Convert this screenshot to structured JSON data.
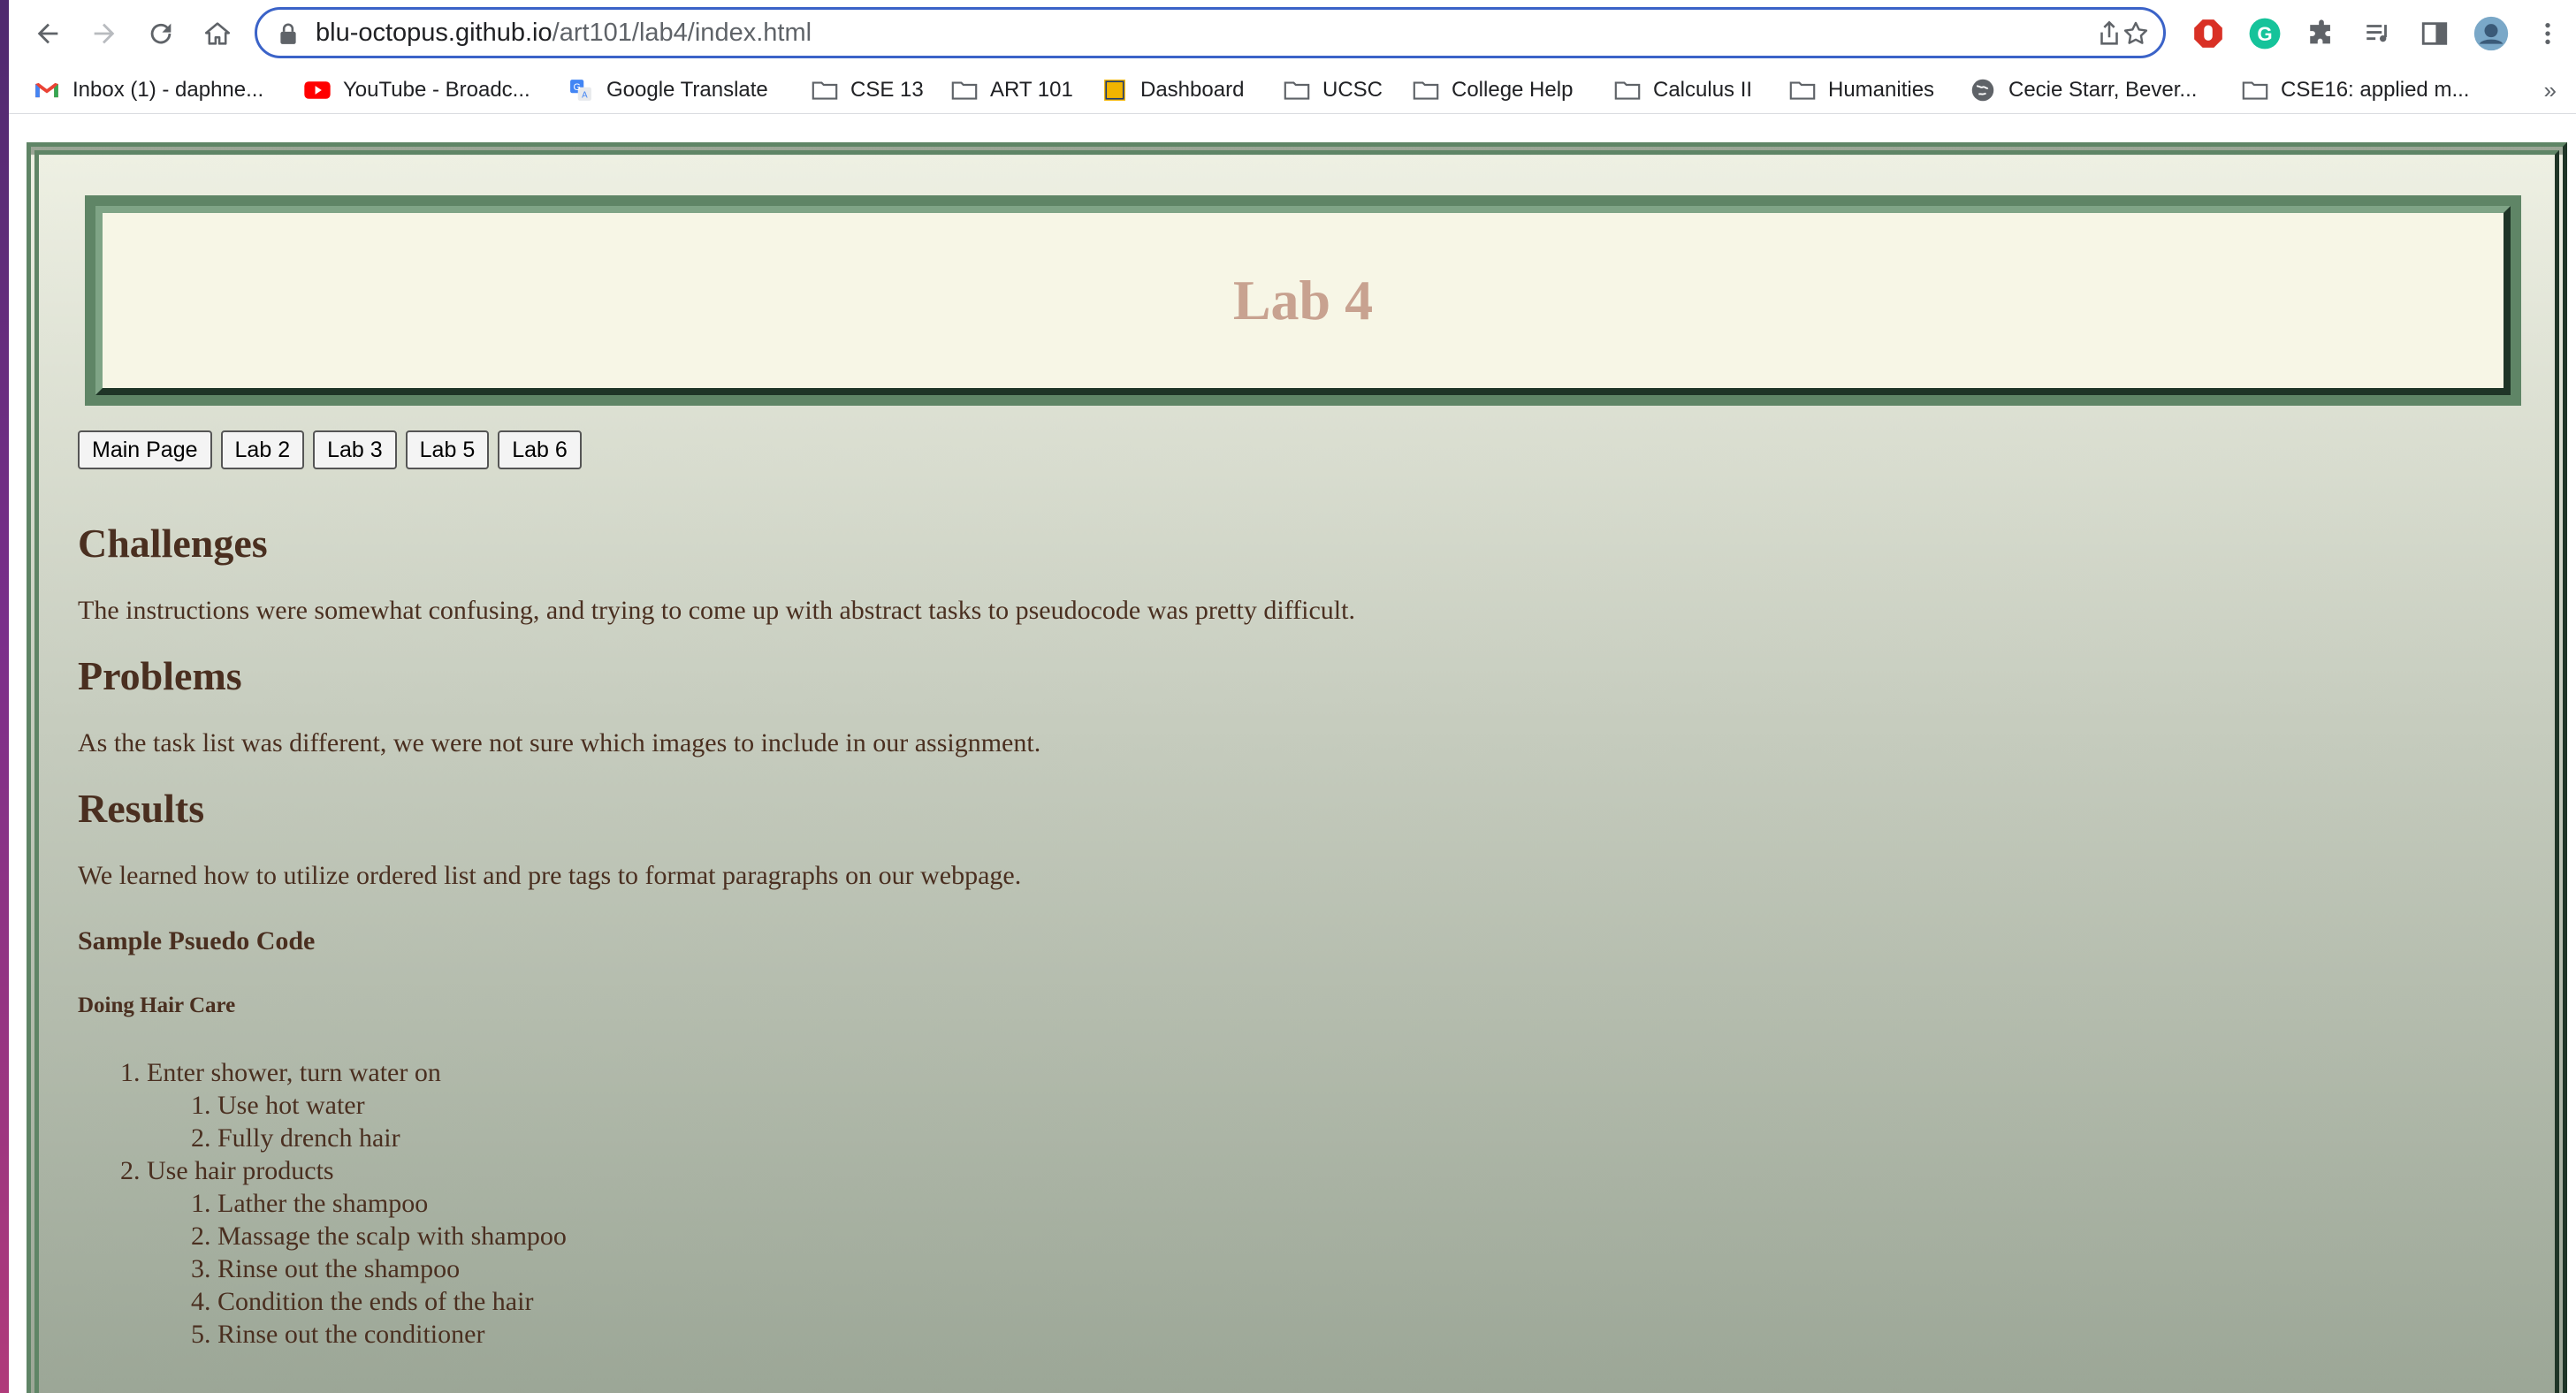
{
  "browser": {
    "url_host": "blu-octopus.github.io",
    "url_path": "/art101/lab4/index.html",
    "bookmarks": [
      {
        "label": "Inbox (1) - daphne...",
        "icon": "gmail-icon"
      },
      {
        "label": "YouTube - Broadc...",
        "icon": "youtube-icon"
      },
      {
        "label": "Google Translate",
        "icon": "google-translate-icon"
      },
      {
        "label": "CSE 13",
        "icon": "folder-icon"
      },
      {
        "label": "ART 101",
        "icon": "folder-icon"
      },
      {
        "label": "Dashboard",
        "icon": "ucsc-icon"
      },
      {
        "label": "UCSC",
        "icon": "folder-icon"
      },
      {
        "label": "College Help",
        "icon": "folder-icon"
      },
      {
        "label": "Calculus II",
        "icon": "folder-icon"
      },
      {
        "label": "Humanities",
        "icon": "folder-icon"
      },
      {
        "label": "Cecie Starr, Bever...",
        "icon": "globe-icon"
      },
      {
        "label": "CSE16: applied m...",
        "icon": "folder-icon"
      }
    ],
    "overflow_label": "»"
  },
  "page": {
    "title": "Lab 4",
    "nav_buttons": [
      "Main Page",
      "Lab 2",
      "Lab 3",
      "Lab 5",
      "Lab 6"
    ],
    "sections": {
      "challenges": {
        "heading": "Challenges",
        "text": "The instructions were somewhat confusing, and trying to come up with abstract tasks to pseudocode was pretty difficult."
      },
      "problems": {
        "heading": "Problems",
        "text": "As the task list was different, we were not sure which images to include in our assignment."
      },
      "results": {
        "heading": "Results",
        "text": "We learned how to utilize ordered list and pre tags to format paragraphs on our webpage."
      }
    },
    "pseudo_heading": "Sample Psuedo Code",
    "task_heading": "Doing Hair Care",
    "steps": [
      {
        "text": "1. Enter shower, turn water on",
        "substeps": [
          "1. Use hot water",
          "2. Fully drench hair"
        ]
      },
      {
        "text": "2. Use hair products",
        "substeps": [
          "1. Lather the shampoo",
          "2. Massage the scalp with shampoo",
          "3. Rinse out the shampoo",
          "4. Condition the ends of the hair",
          "5. Rinse out the conditioner"
        ]
      }
    ]
  }
}
